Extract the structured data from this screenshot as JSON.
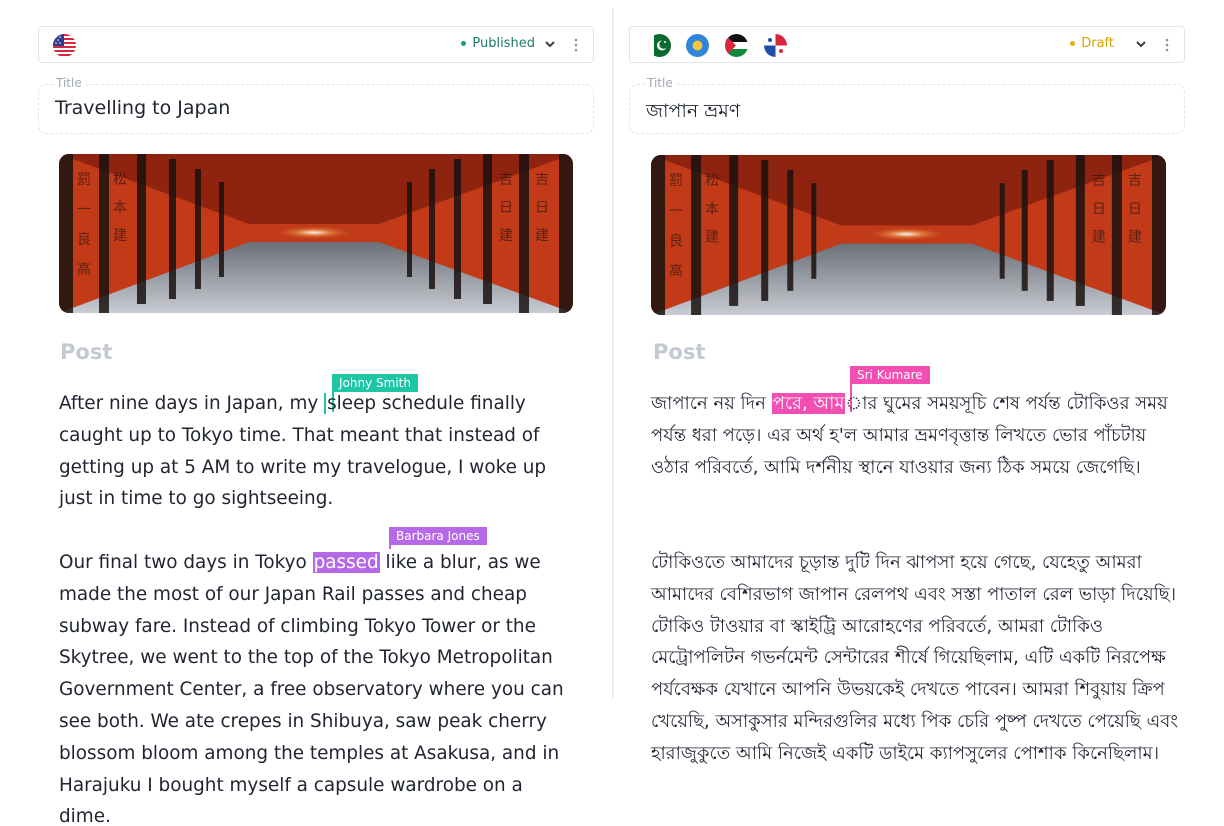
{
  "left": {
    "status": "Published",
    "status_color": "#1a9e7f",
    "title_label": "Title",
    "title": "Travelling to Japan",
    "post_label": "Post",
    "para1": {
      "before": "After nine days in Japan, my ",
      "highlight": "sleep",
      "after": " schedule finally caught up to Tokyo time. That meant that instead of getting up at 5 AM to write my travelogue, I woke up just in time to go sightseeing."
    },
    "para2": {
      "before": "Our final two days in Tokyo ",
      "highlight": "passed",
      "after": " like a blur, as we made the most of our Japan Rail passes and cheap subway fare. Instead of climbing Tokyo Tower or the Skytree, we went to the top of the Tokyo Metropolitan Government Center, a free observatory where you can see both. We ate crepes in Shibuya, saw peak cherry blossom bloom among the temples at Asakusa, and in Harajuku I bought myself a capsule wardrobe on a dime."
    },
    "collaborators": [
      {
        "name": "Johny Smith",
        "color": "#1ec6a4"
      },
      {
        "name": "Barbara Jones",
        "color": "#b569e6"
      }
    ]
  },
  "right": {
    "status": "Draft",
    "status_color": "#e2b007",
    "title_label": "Title",
    "title": "জাপান ভ্রমণ",
    "post_label": "Post",
    "para1": {
      "before": "জাপানে নয় দিন ",
      "highlight": "পরে, আম",
      "after": "ার ঘুমের সময়সূচি শেষ পর্যন্ত টোকিওর সময় পর্যন্ত ধরা পড়ে। এর অর্থ হ'ল আমার ভ্রমণবৃত্তান্ত লিখতে ভোর পাঁচটায় ওঠার পরিবর্তে, আমি দর্শনীয় স্থানে যাওয়ার জন্য ঠিক সময়ে জেগেছি।"
    },
    "para2": "টোকিওতে আমাদের চূড়ান্ত দুটি দিন ঝাপসা হয়ে গেছে, যেহেতু আমরা আমাদের বেশিরভাগ জাপান রেলপথ এবং সস্তা পাতাল রেল ভাড়া দিয়েছি। টোকিও টাওয়ার বা স্কাইট্রি আরোহণের পরিবর্তে, আমরা টোকিও মেট্রোপলিটন গভর্নমেন্ট সেন্টারের শীর্ষে গিয়েছিলাম, এটি একটি নিরপেক্ষ পর্যবেক্ষক যেখানে আপনি উভয়কেই দেখতে পাবেন। আমরা শিবুয়ায় ক্রিপ খেয়েছি, অসাকুসার মন্দিরগুলির মধ্যে পিক চেরি পুষ্প দেখতে পেয়েছি এবং হারাজুকুতে আমি নিজেই একটি ডাইমে ক্যাপসুলের পোশাক কিনেছিলাম।",
    "collaborators": [
      {
        "name": "Sri Kumare",
        "color": "#f14fb2"
      }
    ]
  },
  "icons": {
    "left_flags": [
      "us-flag-icon"
    ],
    "right_flags": [
      "pakistan-flag-icon",
      "circle-flag-icon",
      "palestine-flag-icon",
      "panama-flag-icon"
    ],
    "dropdown": "chevron-down-icon",
    "menu": "kebab-menu-icon"
  }
}
